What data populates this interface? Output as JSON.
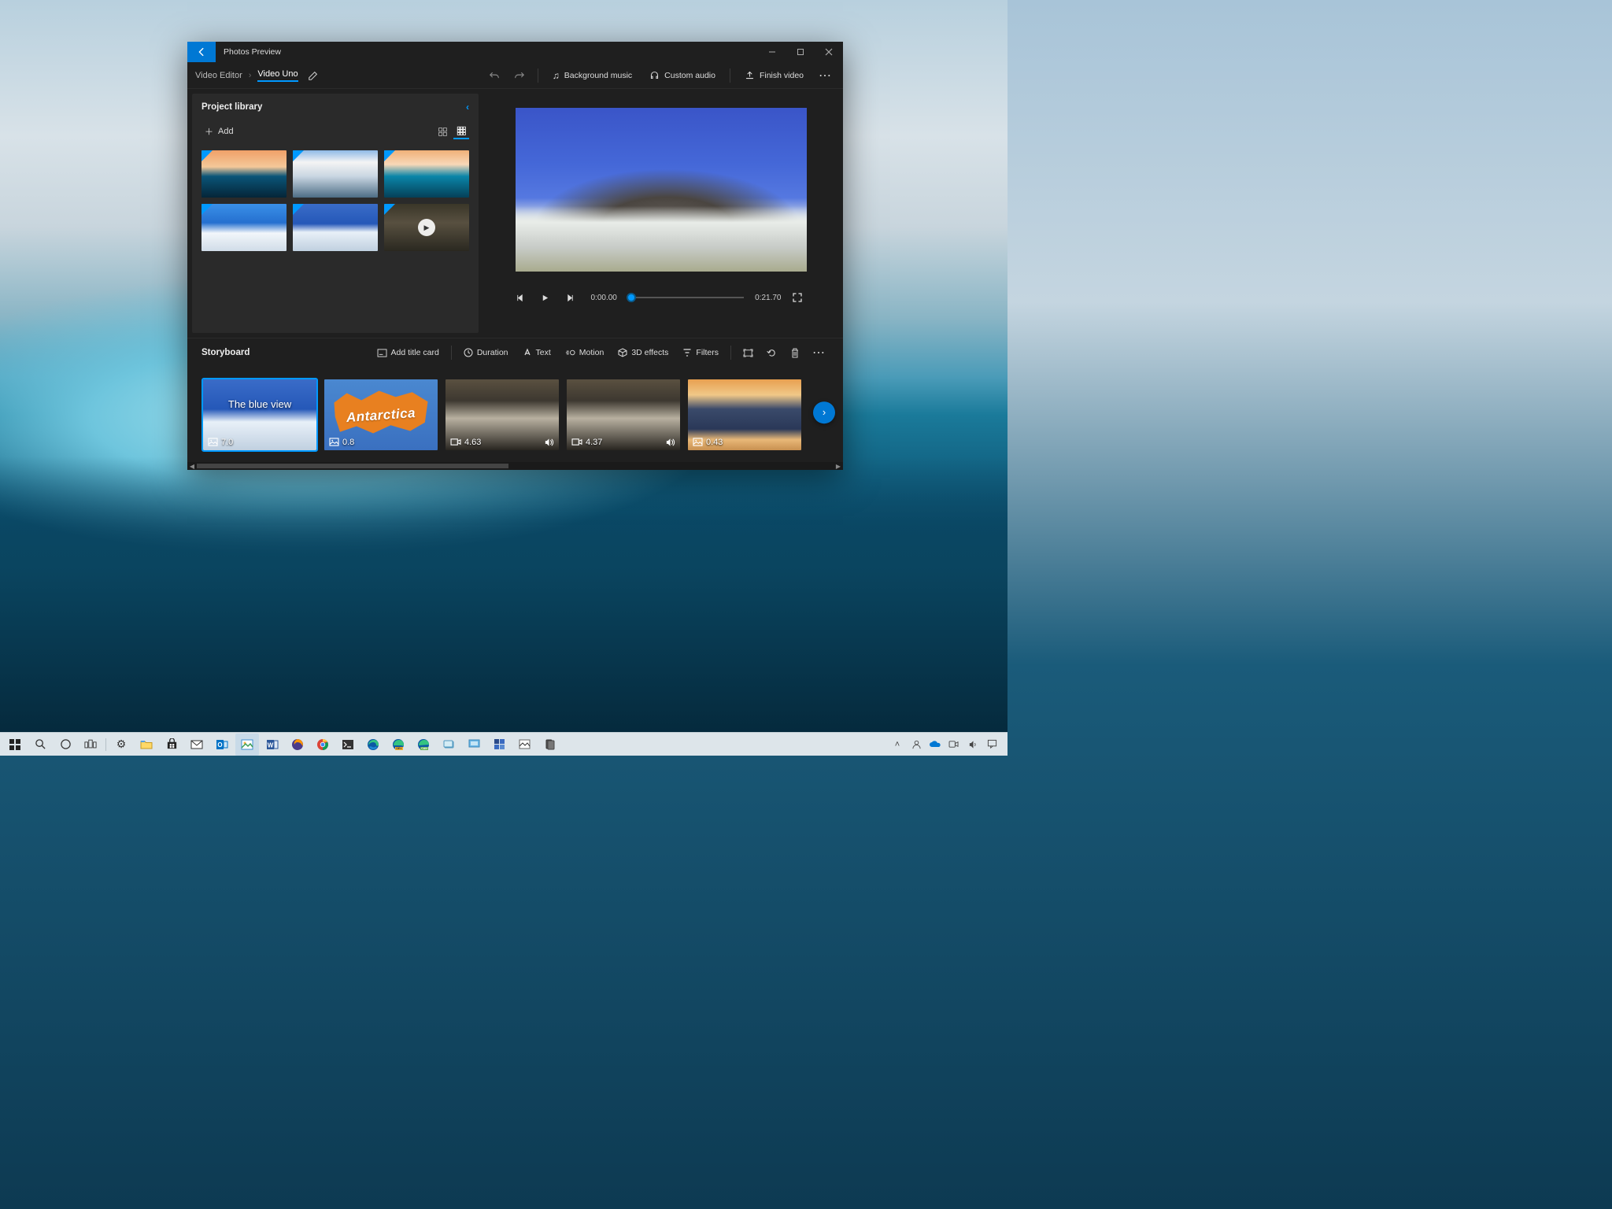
{
  "window": {
    "title": "Photos Preview",
    "breadcrumb": {
      "root": "Video Editor",
      "current": "Video Uno"
    }
  },
  "commands": {
    "background_music": "Background music",
    "custom_audio": "Custom audio",
    "finish_video": "Finish video"
  },
  "library": {
    "title": "Project library",
    "add_label": "Add"
  },
  "transport": {
    "current_time": "0:00.00",
    "total_time": "0:21.70"
  },
  "storyboard": {
    "title": "Storyboard",
    "tools": {
      "add_title_card": "Add title card",
      "duration": "Duration",
      "text": "Text",
      "motion": "Motion",
      "effects_3d": "3D effects",
      "filters": "Filters"
    },
    "clips": [
      {
        "title": "The blue view",
        "duration": "7.0",
        "type": "image",
        "selected": true
      },
      {
        "title": "Antarctica",
        "duration": "0.8",
        "type": "image",
        "selected": false
      },
      {
        "title": "",
        "duration": "4.63",
        "type": "video",
        "has_audio": true,
        "selected": false
      },
      {
        "title": "",
        "duration": "4.37",
        "type": "video",
        "has_audio": true,
        "selected": false
      },
      {
        "title": "",
        "duration": "0.43",
        "type": "image",
        "selected": false
      }
    ]
  },
  "icons": {
    "image": "🖼",
    "video": "🎞",
    "audio": "🔊"
  }
}
